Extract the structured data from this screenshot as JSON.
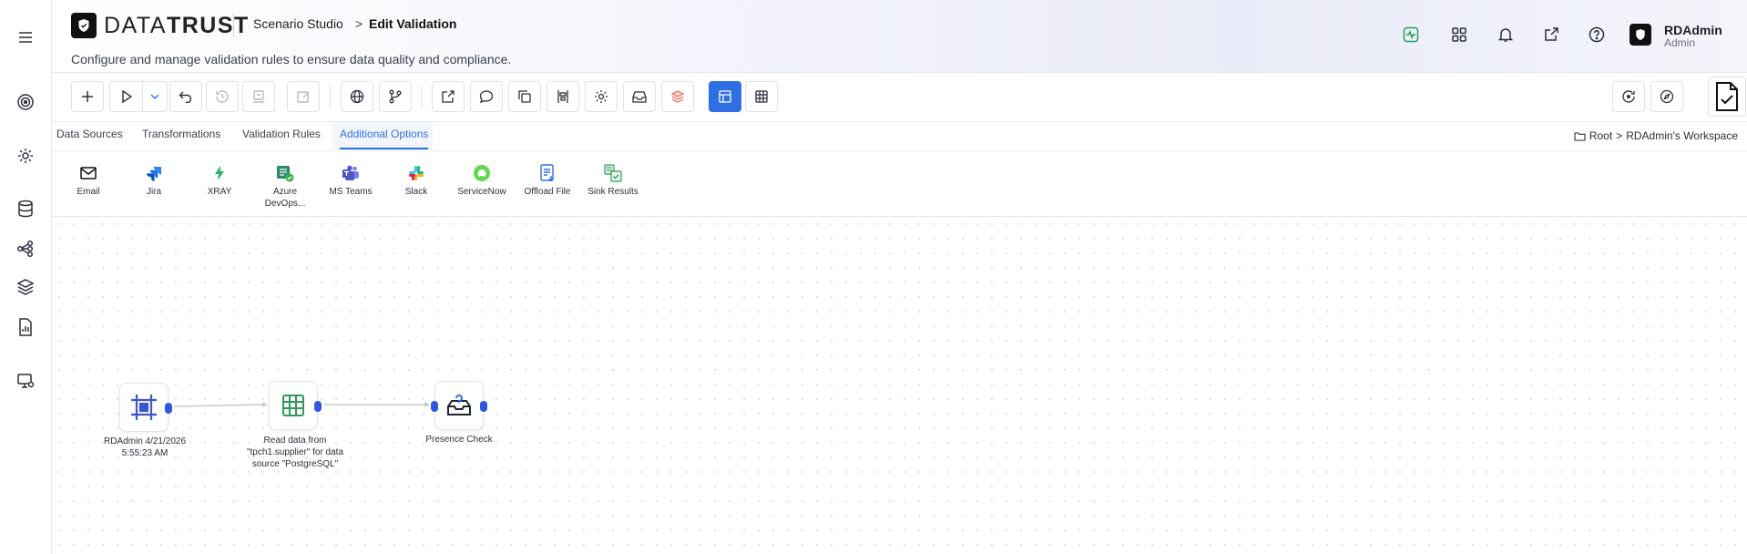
{
  "header": {
    "brand_a": "DATA",
    "brand_b": "TRUST",
    "breadcrumb_1": "Scenario Studio",
    "breadcrumb_sep": ">",
    "breadcrumb_2": "Edit Validation",
    "subtitle": "Configure and manage validation rules to ensure data quality and compliance.",
    "user_name": "RDAdmin",
    "user_role": "Admin"
  },
  "tabs": [
    {
      "label": "Data Sources"
    },
    {
      "label": "Transformations"
    },
    {
      "label": "Validation Rules"
    },
    {
      "label": "Additional Options",
      "active": true
    }
  ],
  "workspace": {
    "root": "Root",
    "sep": ">",
    "name": "RDAdmin's Workspace"
  },
  "options": [
    {
      "label": "Email",
      "icon": "mail-icon"
    },
    {
      "label": "Jira",
      "icon": "jira-icon"
    },
    {
      "label": "XRAY",
      "icon": "xray-icon"
    },
    {
      "label": "Azure DevOps...",
      "icon": "azure-devops-icon"
    },
    {
      "label": "MS Teams",
      "icon": "ms-teams-icon"
    },
    {
      "label": "Slack",
      "icon": "slack-icon"
    },
    {
      "label": "ServiceNow",
      "icon": "servicenow-icon"
    },
    {
      "label": "Offload File",
      "icon": "offload-file-icon"
    },
    {
      "label": "Sink Results",
      "icon": "sink-results-icon"
    }
  ],
  "nodes": [
    {
      "label": "RDAdmin 4/21/2026 5:55:23 AM",
      "icon": "frame-icon"
    },
    {
      "label": "Read data from \"tpch1.supplier\" for data source \"PostgreSQL\"",
      "icon": "table-icon"
    },
    {
      "label": "Presence Check",
      "icon": "presence-check-icon"
    }
  ],
  "colors": {
    "accent": "#2f6fe4",
    "port": "#3057e0",
    "brand_dark": "#111111"
  }
}
